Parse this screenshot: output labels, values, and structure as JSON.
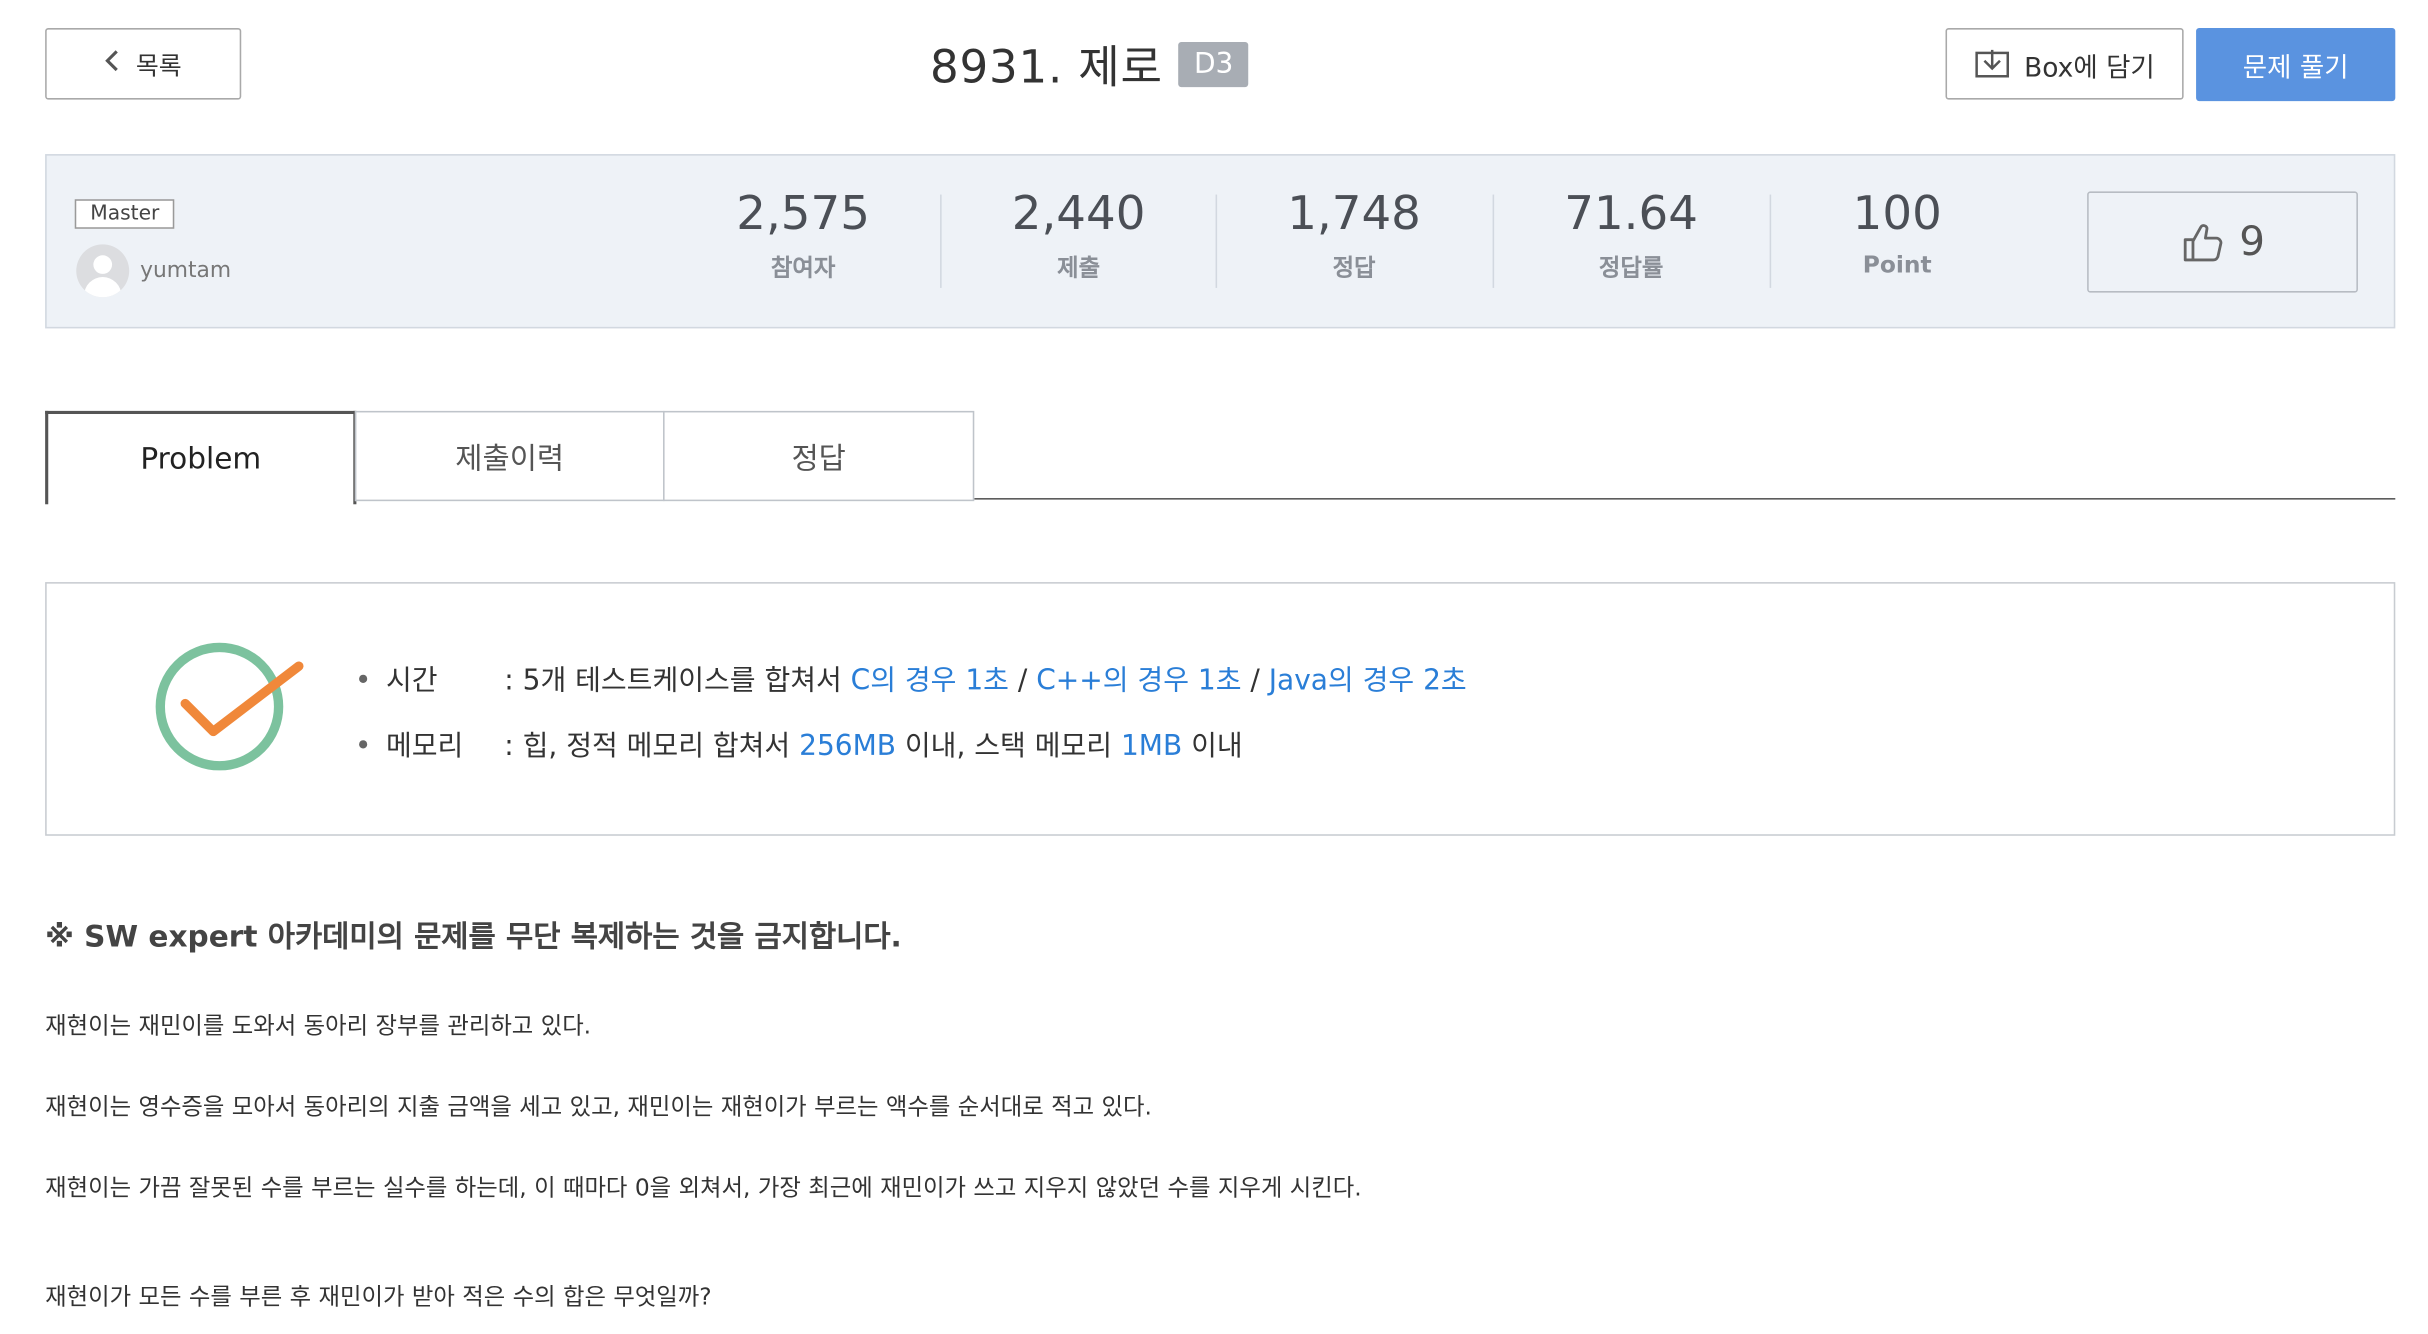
{
  "header": {
    "back_label": "목록",
    "problem_title": "8931. 제로",
    "level": "D3",
    "box_label": "Box에 담기",
    "solve_label": "문제 풀기"
  },
  "stats": {
    "badge": "Master",
    "author": "yumtam",
    "participants": {
      "value": "2,575",
      "label": "참여자"
    },
    "submissions": {
      "value": "2,440",
      "label": "제출"
    },
    "correct": {
      "value": "1,748",
      "label": "정답"
    },
    "accuracy": {
      "value": "71.64",
      "label": "정답률"
    },
    "points": {
      "value": "100",
      "label": "Point"
    },
    "likes": "9"
  },
  "tabs": [
    {
      "label": "Problem",
      "active": true
    },
    {
      "label": "제출이력",
      "active": false
    },
    {
      "label": "정답",
      "active": false
    }
  ],
  "limits": {
    "time_label": "시간",
    "time_prefix": ": 5개 테스트케이스를 합쳐서 ",
    "c_limit": "C의 경우 1초",
    "sep1": " / ",
    "cpp_limit": "C++의 경우 1초",
    "sep2": " / ",
    "java_limit": "Java의 경우 2초",
    "memory_label": "메모리",
    "memory_prefix": ": 힙, 정적 메모리 합쳐서 ",
    "heap_limit": "256MB",
    "memory_mid": " 이내, 스택 메모리 ",
    "stack_limit": "1MB",
    "memory_suffix": " 이내"
  },
  "content": {
    "notice": "※ SW expert 아카데미의 문제를 무단 복제하는 것을 금지합니다.",
    "paragraphs": [
      "재현이는 재민이를 도와서 동아리 장부를 관리하고 있다.",
      "재현이는 영수증을 모아서 동아리의 지출 금액을 세고 있고, 재민이는 재현이가 부르는 액수를 순서대로 적고 있다.",
      "재현이는 가끔 잘못된 수를 부르는 실수를 하는데, 이 때마다 0을 외쳐서, 가장 최근에 재민이가 쓰고 지우지 않았던 수를 지우게 시킨다.",
      "재현이가 모든 수를 부른 후 재민이가 받아 적은 수의 합은 무엇일까?"
    ]
  },
  "colors": {
    "accent": "#5a93e0",
    "link": "#2a7ed7",
    "check_ring": "#7cc29e",
    "check_mark": "#f0883a"
  }
}
